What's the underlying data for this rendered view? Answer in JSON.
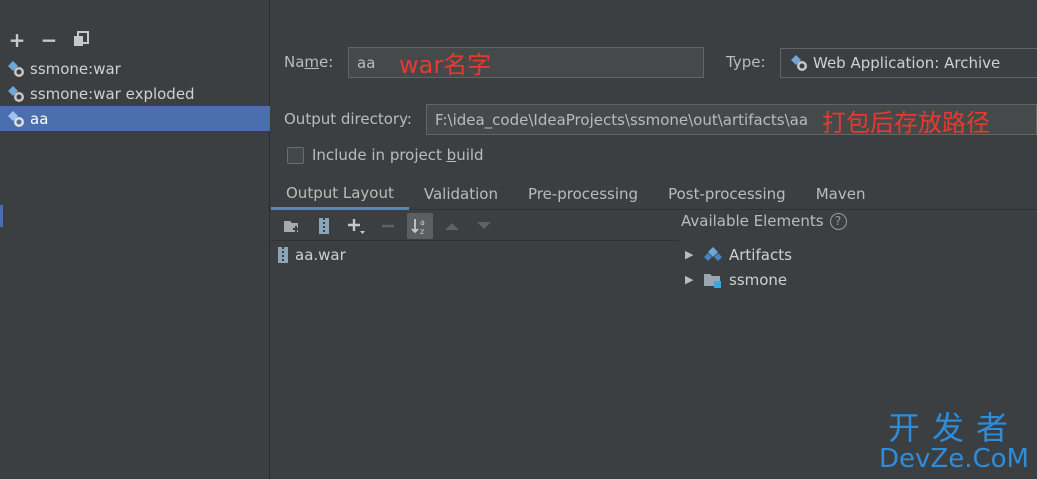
{
  "left_toolbar": {
    "add": "+",
    "remove": "−"
  },
  "artifacts": [
    {
      "label": "ssmone:war",
      "selected": false
    },
    {
      "label": "ssmone:war exploded",
      "selected": false
    },
    {
      "label": "aa",
      "selected": true
    }
  ],
  "name": {
    "label_pre": "Na",
    "label_mnemonic": "m",
    "label_post": "e:",
    "value": "aa",
    "annotation": "war名字"
  },
  "type": {
    "label": "Type:",
    "value": "Web Application: Archive"
  },
  "output": {
    "label": "Output directory:",
    "value": "F:\\idea_code\\IdeaProjects\\ssmone\\out\\artifacts\\aa",
    "annotation": "打包后存放路径"
  },
  "include_build": {
    "label_pre": "Include in project ",
    "label_mnemonic": "b",
    "label_post": "uild",
    "checked": false
  },
  "tabs": [
    {
      "label": "Output Layout",
      "active": true
    },
    {
      "label": "Validation",
      "active": false
    },
    {
      "label": "Pre-processing",
      "active": false
    },
    {
      "label": "Post-processing",
      "active": false
    },
    {
      "label": "Maven",
      "active": false
    }
  ],
  "layout_tree": [
    {
      "label": "aa.war"
    }
  ],
  "available": {
    "title": "Available Elements",
    "help": "?",
    "items": [
      {
        "label": "Artifacts"
      },
      {
        "label": "ssmone"
      }
    ]
  },
  "watermark": {
    "line1": "开发者",
    "line2": "DevZe.CoM"
  },
  "colors": {
    "accent": "#4b6eaf",
    "annotation": "#e53b2f",
    "watermark": "#2e8cd8"
  }
}
